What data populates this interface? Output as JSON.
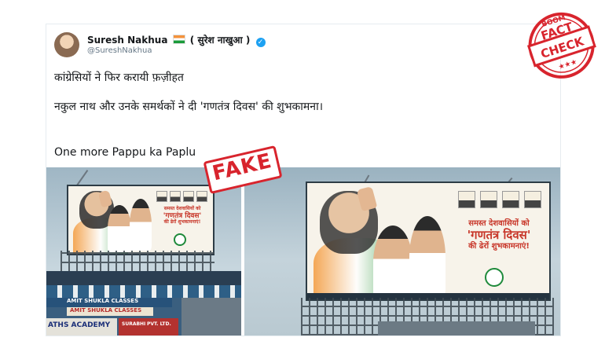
{
  "tweet": {
    "display_name": "Suresh Nakhua",
    "display_name_hindi": "( सुरेश नाखुआ )",
    "handle": "@SureshNakhua",
    "text_line1": "कांग्रेसियों ने फिर करायी फ़ज़ीहत",
    "text_line2": "नकुल नाथ और उनके समर्थकों ने दी 'गणतंत्र दिवस' की शुभकामना।",
    "text_line3": "One more Pappu ka Paplu",
    "more_icon": "chevron-down-icon",
    "verified_icon": "verified-badge-icon"
  },
  "images": {
    "left": {
      "billboard_line1": "समस्त देशवासियों को",
      "billboard_line2": "'गणतंत्र दिवस'",
      "billboard_line3": "की ढेरों शुभकामनाएं!",
      "shop_sign_1": "AMIT SHUKLA CLASSES",
      "shop_sign_2": "AMIT SHUKLA CLASSES",
      "shop_sign_3": "ATHS ACADEMY",
      "shop_sign_4": "SURABHI",
      "shop_sign_5": "PVT. LTD."
    },
    "right": {
      "billboard_line1": "समस्त देशवासियों को",
      "billboard_line2": "'गणतंत्र दिवस'",
      "billboard_line3": "की ढेरों शुभकामनाएं!"
    }
  },
  "stamps": {
    "fake_label": "FAKE",
    "badge_top": "BOOM",
    "badge_line1": "FACT",
    "badge_line2": "CHECK",
    "badge_stars": "★★★"
  },
  "colors": {
    "stamp_red": "#d8242d",
    "twitter_blue": "#1da1f2"
  }
}
